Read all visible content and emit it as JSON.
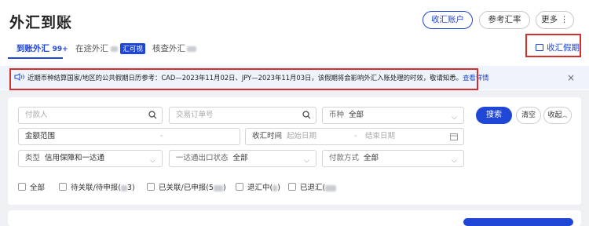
{
  "header": {
    "title": "外汇到账",
    "help": "?"
  },
  "actions": {
    "collect_account": "收汇账户",
    "reference_rate": "参考汇率",
    "more": "更多 ⋮"
  },
  "tabs": [
    {
      "label": "到账外汇 ",
      "badge": "99+"
    },
    {
      "label": "在途外汇 ",
      "tag": "汇可视"
    },
    {
      "label": "核查外汇"
    }
  ],
  "holiday": {
    "label": "收汇假期",
    "icon": "calendar-icon"
  },
  "notice": {
    "text": "近期币种结算国家/地区的公共假期日历参考：CAD—2023年11月02日、JPY—2023年11月03日，该假期将会影响外汇入账处理的时效，敬请知悉。",
    "link": "查看详情",
    "close": "×"
  },
  "filters": {
    "payer_placeholder": "付款人",
    "order_placeholder": "交易订单号",
    "currency_label": "币种",
    "currency_value": "全部",
    "amount_label": "金额范围",
    "amount_sep": "-",
    "collect_time_label": "收汇时间",
    "start_date": "起始日期",
    "date_sep": "-",
    "end_date": "结束日期",
    "type_label": "类型",
    "type_value": "信用保障和一达通",
    "ydt_label": "一达通出口状态",
    "ydt_value": "全部",
    "pay_method_label": "付款方式",
    "pay_method_value": "全部",
    "search": "搜索",
    "clear": "清空",
    "collapse": "收起"
  },
  "status_checks": [
    {
      "label": "全部"
    },
    {
      "label": "待关联/待申报(",
      "tail": "3)"
    },
    {
      "label": "已关联/已申报(5",
      "tail": ")"
    },
    {
      "label": "退汇中(",
      "tail": ")"
    },
    {
      "label": "已退汇(",
      "tail": ""
    }
  ],
  "colors": {
    "accent": "#2046d6",
    "highlight": "#d32f2f",
    "notice_bg": "#eef3fc"
  }
}
